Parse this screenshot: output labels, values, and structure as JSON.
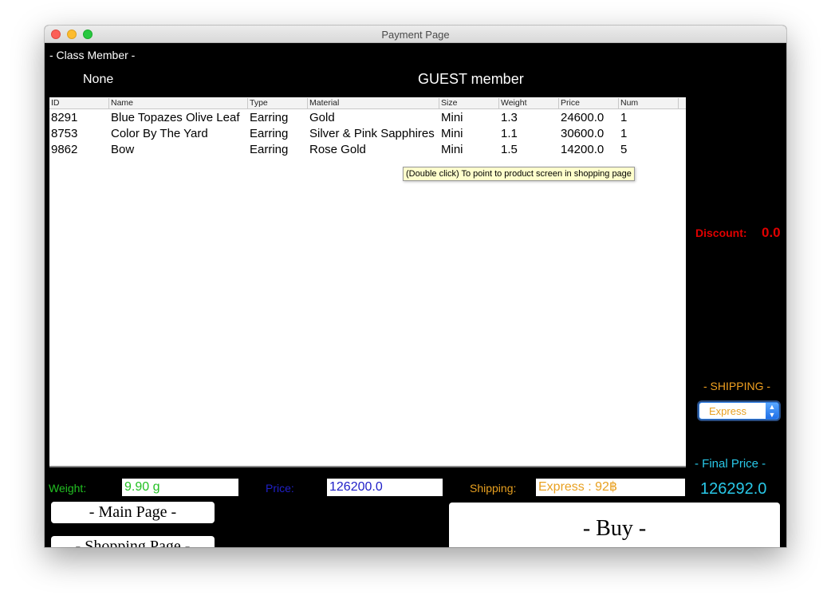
{
  "window": {
    "title": "Payment Page"
  },
  "member": {
    "class_label": "- Class Member -",
    "class_value": "None",
    "member_type": "GUEST member"
  },
  "table": {
    "columns": [
      "ID",
      "Name",
      "Type",
      "Material",
      "Size",
      "Weight",
      "Price",
      "Num"
    ],
    "rows": [
      [
        "8291",
        "Blue Topazes Olive Leaf",
        "Earring",
        "Gold",
        "Mini",
        "1.3",
        "24600.0",
        "1"
      ],
      [
        "8753",
        "Color By The Yard",
        "Earring",
        "Silver & Pink Sapphires",
        "Mini",
        "1.1",
        "30600.0",
        "1"
      ],
      [
        "9862",
        "Bow",
        "Earring",
        "Rose Gold",
        "Mini",
        "1.5",
        "14200.0",
        "5"
      ]
    ],
    "tooltip": "(Double click) To point to product screen in shopping page"
  },
  "discount": {
    "label": "Discount:",
    "value": "0.0"
  },
  "shipping": {
    "heading": "- SHIPPING -",
    "selected": "Express"
  },
  "final_price": {
    "label": "- Final Price -",
    "value": "126292.0"
  },
  "summary": {
    "weight_label": "Weight:",
    "weight_value": "9.90 g",
    "price_label": "Price:",
    "price_value": "126200.0",
    "shipping_label": "Shipping:",
    "shipping_value": "Express : 92฿"
  },
  "buttons": {
    "main_page": "- Main Page -",
    "shopping_page": "- Shopping Page -",
    "buy": "- Buy -"
  },
  "colors": {
    "discount": "#e00000",
    "shipping": "#e8a020",
    "final_price": "#29c8e8",
    "weight": "#22c022",
    "price": "#2020c8"
  }
}
